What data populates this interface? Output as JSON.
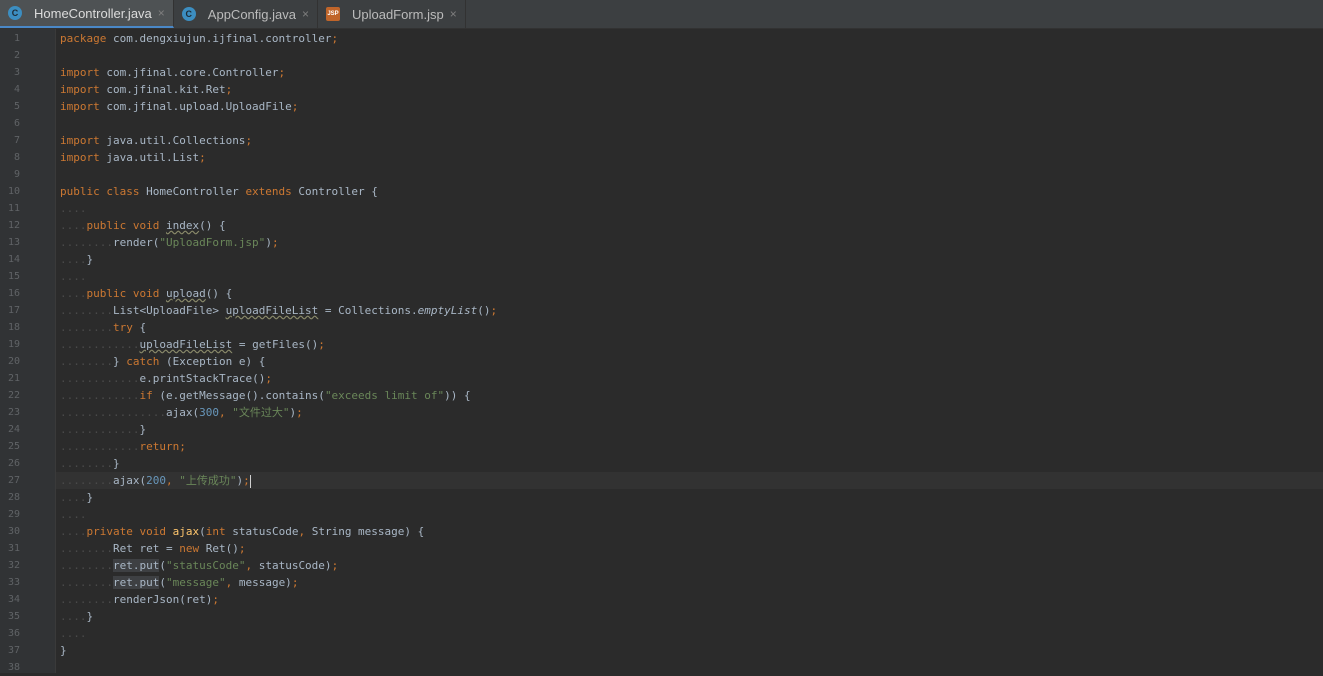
{
  "tabs": [
    {
      "label": "HomeController.java",
      "icon": "java-class-icon",
      "badge": "C",
      "active": true,
      "close": "×"
    },
    {
      "label": "AppConfig.java",
      "icon": "java-class-icon",
      "badge": "C",
      "active": false,
      "close": "×"
    },
    {
      "label": "UploadForm.jsp",
      "icon": "jsp-file-icon",
      "badge": "JSP",
      "active": false,
      "close": "×"
    }
  ],
  "current_line": 27,
  "lines": [
    {
      "n": "1",
      "segs": [
        [
          "kw",
          "package "
        ],
        [
          "",
          "com.dengxiujun.ijfinal.controller"
        ],
        [
          "kw",
          ";"
        ]
      ]
    },
    {
      "n": "2",
      "segs": []
    },
    {
      "n": "3",
      "segs": [
        [
          "kw",
          "import "
        ],
        [
          "",
          "com.jfinal.core.Controller"
        ],
        [
          "kw",
          ";"
        ]
      ]
    },
    {
      "n": "4",
      "segs": [
        [
          "kw",
          "import "
        ],
        [
          "",
          "com.jfinal.kit.Ret"
        ],
        [
          "kw",
          ";"
        ]
      ]
    },
    {
      "n": "5",
      "segs": [
        [
          "kw",
          "import "
        ],
        [
          "",
          "com.jfinal.upload.UploadFile"
        ],
        [
          "kw",
          ";"
        ]
      ]
    },
    {
      "n": "6",
      "segs": []
    },
    {
      "n": "7",
      "segs": [
        [
          "kw",
          "import "
        ],
        [
          "",
          "java.util.Collections"
        ],
        [
          "kw",
          ";"
        ]
      ]
    },
    {
      "n": "8",
      "segs": [
        [
          "kw",
          "import "
        ],
        [
          "",
          "java.util.List"
        ],
        [
          "kw",
          ";"
        ]
      ]
    },
    {
      "n": "9",
      "segs": []
    },
    {
      "n": "10",
      "segs": [
        [
          "kw",
          "public class "
        ],
        [
          "",
          "HomeController "
        ],
        [
          "kw",
          "extends "
        ],
        [
          "",
          "Controller {"
        ]
      ]
    },
    {
      "n": "11",
      "segs": [
        [
          "dots",
          "...."
        ]
      ]
    },
    {
      "n": "12",
      "segs": [
        [
          "dots",
          "...."
        ],
        [
          "kw",
          "public void "
        ],
        [
          "squig",
          "index"
        ],
        [
          "",
          "() {"
        ]
      ]
    },
    {
      "n": "13",
      "segs": [
        [
          "dots",
          "........"
        ],
        [
          "",
          "render("
        ],
        [
          "str",
          "\"UploadForm.jsp\""
        ],
        [
          "",
          ")"
        ],
        [
          "kw",
          ";"
        ]
      ]
    },
    {
      "n": "14",
      "segs": [
        [
          "dots",
          "...."
        ],
        [
          "",
          "}"
        ]
      ]
    },
    {
      "n": "15",
      "segs": [
        [
          "dots",
          "...."
        ]
      ]
    },
    {
      "n": "16",
      "segs": [
        [
          "dots",
          "...."
        ],
        [
          "kw",
          "public void "
        ],
        [
          "squig",
          "upload"
        ],
        [
          "",
          "() {"
        ]
      ]
    },
    {
      "n": "17",
      "segs": [
        [
          "dots",
          "........"
        ],
        [
          "",
          "List<UploadFile> "
        ],
        [
          "squig",
          "uploadFileList"
        ],
        [
          "",
          " = Collections."
        ],
        [
          "it",
          "emptyList"
        ],
        [
          "",
          "()"
        ],
        [
          "kw",
          ";"
        ]
      ]
    },
    {
      "n": "18",
      "segs": [
        [
          "dots",
          "........"
        ],
        [
          "kw",
          "try "
        ],
        [
          "",
          "{"
        ]
      ]
    },
    {
      "n": "19",
      "segs": [
        [
          "dots",
          "............"
        ],
        [
          "squig",
          "uploadFileList"
        ],
        [
          "",
          " = getFiles()"
        ],
        [
          "kw",
          ";"
        ]
      ]
    },
    {
      "n": "20",
      "segs": [
        [
          "dots",
          "........"
        ],
        [
          "",
          "} "
        ],
        [
          "kw",
          "catch "
        ],
        [
          "",
          "(Exception e) {"
        ]
      ]
    },
    {
      "n": "21",
      "segs": [
        [
          "dots",
          "............"
        ],
        [
          "",
          "e.printStackTrace()"
        ],
        [
          "kw",
          ";"
        ]
      ]
    },
    {
      "n": "22",
      "segs": [
        [
          "dots",
          "............"
        ],
        [
          "kw",
          "if "
        ],
        [
          "",
          "(e.getMessage().contains("
        ],
        [
          "str",
          "\"exceeds limit of\""
        ],
        [
          "",
          ")) {"
        ]
      ]
    },
    {
      "n": "23",
      "segs": [
        [
          "dots",
          "................"
        ],
        [
          "",
          "ajax("
        ],
        [
          "num",
          "300"
        ],
        [
          "kw",
          ", "
        ],
        [
          "str",
          "\"文件过大\""
        ],
        [
          "",
          ")"
        ],
        [
          "kw",
          ";"
        ]
      ]
    },
    {
      "n": "24",
      "segs": [
        [
          "dots",
          "............"
        ],
        [
          "",
          "}"
        ]
      ]
    },
    {
      "n": "25",
      "segs": [
        [
          "dots",
          "............"
        ],
        [
          "kw",
          "return;"
        ]
      ]
    },
    {
      "n": "26",
      "segs": [
        [
          "dots",
          "........"
        ],
        [
          "",
          "}"
        ]
      ]
    },
    {
      "n": "27",
      "segs": [
        [
          "dots",
          "........"
        ],
        [
          "",
          "ajax("
        ],
        [
          "num",
          "200"
        ],
        [
          "kw",
          ", "
        ],
        [
          "str",
          "\"上传成功\""
        ],
        [
          "",
          ")"
        ],
        [
          "kw",
          ";"
        ],
        [
          "caret",
          ""
        ]
      ]
    },
    {
      "n": "28",
      "segs": [
        [
          "dots",
          "...."
        ],
        [
          "",
          "}"
        ]
      ]
    },
    {
      "n": "29",
      "segs": [
        [
          "dots",
          "...."
        ]
      ]
    },
    {
      "n": "30",
      "segs": [
        [
          "dots",
          "...."
        ],
        [
          "kw",
          "private void "
        ],
        [
          "fn",
          "ajax"
        ],
        [
          "",
          "("
        ],
        [
          "kw",
          "int "
        ],
        [
          "",
          "statusCode"
        ],
        [
          "kw",
          ", "
        ],
        [
          "",
          "String message) {"
        ]
      ]
    },
    {
      "n": "31",
      "segs": [
        [
          "dots",
          "........"
        ],
        [
          "",
          "Ret ret = "
        ],
        [
          "kw",
          "new "
        ],
        [
          "",
          "Ret()"
        ],
        [
          "kw",
          ";"
        ]
      ]
    },
    {
      "n": "32",
      "segs": [
        [
          "dots",
          "........"
        ],
        [
          "hl",
          "ret.put"
        ],
        [
          "",
          "("
        ],
        [
          "str",
          "\"statusCode\""
        ],
        [
          "kw",
          ", "
        ],
        [
          "",
          "statusCode)"
        ],
        [
          "kw",
          ";"
        ]
      ]
    },
    {
      "n": "33",
      "segs": [
        [
          "dots",
          "........"
        ],
        [
          "hl",
          "ret.put"
        ],
        [
          "",
          "("
        ],
        [
          "str",
          "\"message\""
        ],
        [
          "kw",
          ", "
        ],
        [
          "",
          "message)"
        ],
        [
          "kw",
          ";"
        ]
      ]
    },
    {
      "n": "34",
      "segs": [
        [
          "dots",
          "........"
        ],
        [
          "",
          "renderJson(ret)"
        ],
        [
          "kw",
          ";"
        ]
      ]
    },
    {
      "n": "35",
      "segs": [
        [
          "dots",
          "...."
        ],
        [
          "",
          "}"
        ]
      ]
    },
    {
      "n": "36",
      "segs": [
        [
          "dots",
          "...."
        ]
      ]
    },
    {
      "n": "37",
      "segs": [
        [
          "",
          "}"
        ]
      ]
    },
    {
      "n": "38",
      "segs": []
    }
  ]
}
